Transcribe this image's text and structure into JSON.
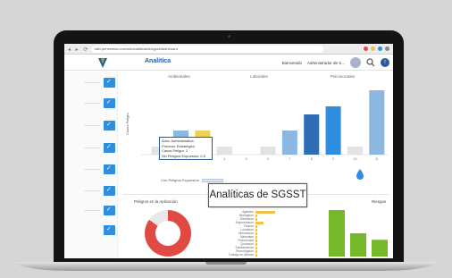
{
  "browser": {
    "url": "sdiv.pensemos.com/sst/analiticas/#/sgsst/dashboard"
  },
  "header": {
    "app_title": "Analitica",
    "user_label": "Bienvenido",
    "admin_label": "Administrador de S...",
    "alert_glyph": "!"
  },
  "bar_chart": {
    "columns": [
      "Ambientales",
      "Laborales",
      "Psicosociales"
    ],
    "tooltip": {
      "line1": "Área: Administrativa",
      "line2": "Proceso: Estratégico",
      "line3": "Casos Peligro: 2",
      "line4": "Sin Peligros Expuestos: 0.0"
    },
    "legend_label": "Con Peligros Expuestos"
  },
  "bottom": {
    "left_title": "Peligros en la Aplicación",
    "right_title": "Riesgos",
    "hbar_labels": [
      "Agentes",
      "Biológicos",
      "Eléctricos",
      "Ergonómicos",
      "Físicos",
      "Locativos",
      "Mecánicos",
      "Naturales",
      "Psicosocial",
      "Químicos",
      "Saneamiento",
      "Tecnológicos",
      "Trabajo en Alturas"
    ]
  },
  "caption": "Analíticas de SGSST",
  "chart_data": [
    {
      "type": "bar",
      "title": "",
      "ylabel": "Casos Peligro",
      "categories": [
        "1",
        "2",
        "3",
        "4",
        "5",
        "6",
        "7",
        "8",
        "9",
        "10",
        "11"
      ],
      "values": [
        1,
        3,
        3,
        1,
        0,
        1,
        3,
        5,
        6,
        1,
        8
      ],
      "ylim": [
        0,
        8
      ],
      "colors": [
        "#e3e3e3",
        "#8ab8e0",
        "#e7d25c",
        "#e3e3e3",
        "#ffffff",
        "#e3e3e3",
        "#8ab8e0",
        "#2e6db4",
        "#2e8ee0",
        "#e3e3e3",
        "#8ab8e0"
      ]
    },
    {
      "type": "pie",
      "values": [
        85,
        15
      ],
      "colors": [
        "#e04a42",
        "#e8e8e8"
      ]
    },
    {
      "type": "bar",
      "values": [
        1,
        0.1,
        0.1,
        0.4,
        0.1,
        0.1,
        0.1,
        0.1,
        0.1,
        0.1,
        0.1,
        0.1,
        0.1
      ],
      "colors": [
        "#f5c04a"
      ]
    },
    {
      "type": "bar",
      "values": [
        5,
        2.5,
        1.8
      ],
      "colors": [
        "#76b82a"
      ]
    }
  ]
}
